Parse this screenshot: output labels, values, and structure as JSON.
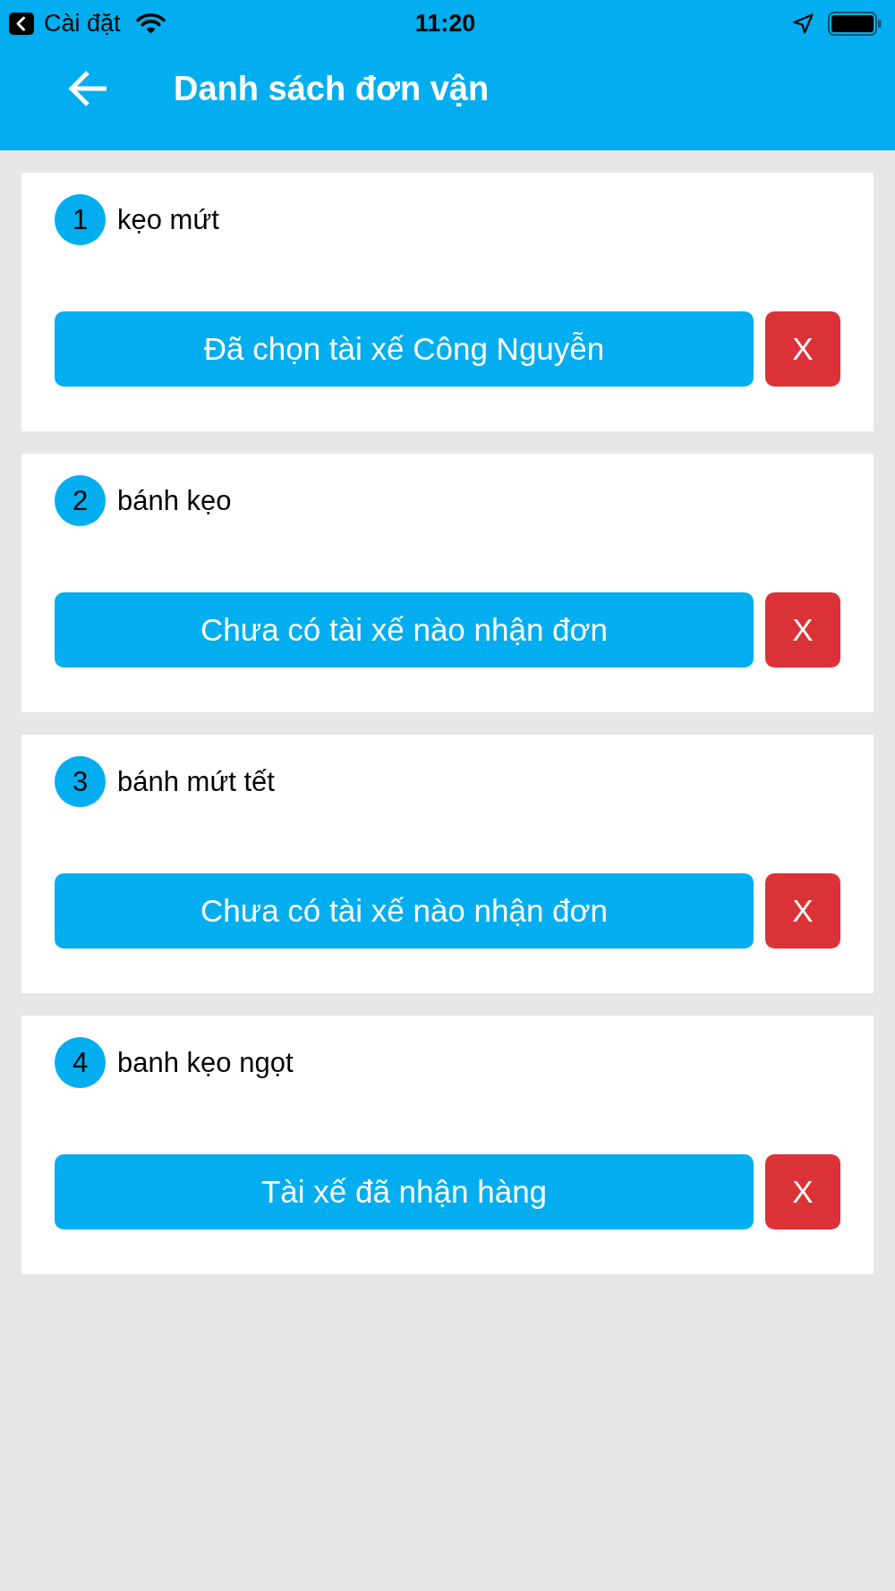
{
  "status_bar": {
    "back_label": "Cài đặt",
    "time": "11:20"
  },
  "header": {
    "title": "Danh sách đơn vận"
  },
  "orders": [
    {
      "number": "1",
      "name": "kẹo mứt",
      "status": "Đã chọn tài xế Công Nguyễn",
      "delete_label": "X"
    },
    {
      "number": "2",
      "name": "bánh kẹo",
      "status": "Chưa có tài xế nào nhận đơn",
      "delete_label": "X"
    },
    {
      "number": "3",
      "name": "bánh mứt tết",
      "status": "Chưa có tài xế nào nhận đơn",
      "delete_label": "X"
    },
    {
      "number": "4",
      "name": "banh kẹo ngọt",
      "status": "Tài xế đã nhận hàng",
      "delete_label": "X"
    }
  ]
}
